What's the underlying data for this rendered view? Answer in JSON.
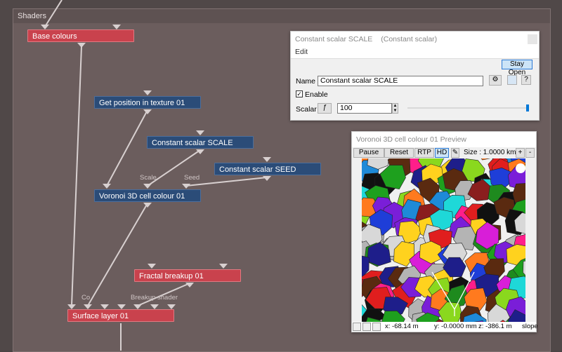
{
  "panel": {
    "title": "Shaders"
  },
  "nodes": {
    "base_colours": "Base colours",
    "get_position": "Get position in texture 01",
    "const_scale": "Constant scalar SCALE",
    "const_seed": "Constant scalar SEED",
    "voronoi": "Voronoi 3D cell colour 01",
    "fractal": "Fractal breakup 01",
    "surface": "Surface layer 01"
  },
  "ports": {
    "scale": "Scale",
    "seed": "Seed",
    "co": "Co",
    "breakup": "Breakup shader"
  },
  "dialog": {
    "title": "Constant scalar SCALE",
    "subtitle": "(Constant scalar)",
    "menu_edit": "Edit",
    "stay_open": "Stay Open",
    "name_label": "Name",
    "name_value": "Constant scalar SCALE",
    "gear_icon": "gear-icon",
    "help": "?",
    "enable_label": "Enable",
    "enable_checked": true,
    "scalar_label": "Scalar",
    "scalar_value": "100",
    "slider_value_fraction": 1.0
  },
  "preview": {
    "title": "Voronoi 3D cell colour 01 Preview",
    "pause": "Pause",
    "reset": "Reset",
    "rtp": "RTP",
    "hd": "HD",
    "size_label": "Size : 1.0000 km",
    "plus": "+",
    "minus": "-",
    "x": "x:  -68.14 m",
    "y": "y:  -0.0000 mm",
    "z": "z:  -386.1 m",
    "slope": "slope"
  },
  "colors": {
    "red_node": "#c9424d",
    "blue_node": "#2b4c78",
    "wire": "#d8d0d0"
  }
}
